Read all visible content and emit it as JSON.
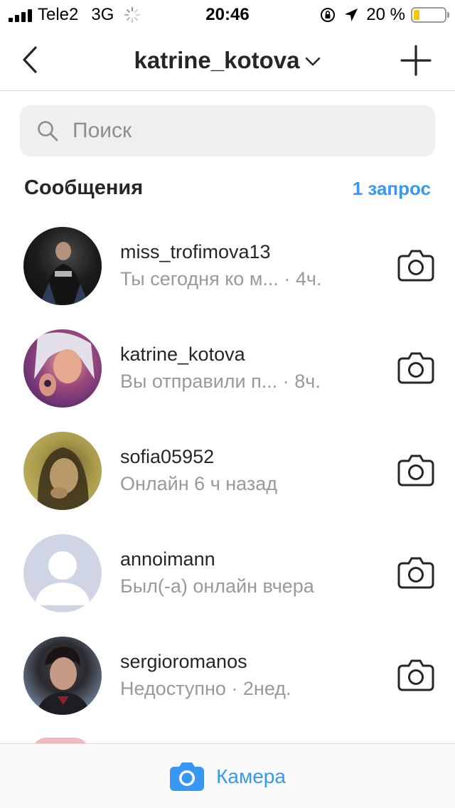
{
  "status_bar": {
    "carrier": "Tele2",
    "network": "3G",
    "time": "20:46",
    "battery_percent": "20 %",
    "battery_level": 0.2,
    "icons": [
      "signal-icon",
      "activity-spinner-icon",
      "orientation-lock-icon",
      "location-arrow-icon",
      "battery-icon"
    ]
  },
  "nav": {
    "title": "katrine_kotova",
    "back_icon": "chevron-left-icon",
    "title_icon": "chevron-down-icon",
    "new_message_icon": "plus-icon"
  },
  "search": {
    "placeholder": "Поиск",
    "icon": "search-icon"
  },
  "messages": {
    "section_title": "Сообщения",
    "requests_label": "1 запрос",
    "items": [
      {
        "username": "miss_trofimova13",
        "subtitle": "Ты сегодня ко м... · 4ч.",
        "icon": "camera-icon"
      },
      {
        "username": "katrine_kotova",
        "subtitle": "Вы отправили п... · 8ч.",
        "icon": "camera-icon"
      },
      {
        "username": "sofia05952",
        "subtitle": "Онлайн 6 ч назад",
        "icon": "camera-icon"
      },
      {
        "username": "annoimann",
        "subtitle": "Был(-а) онлайн вчера",
        "icon": "camera-icon"
      },
      {
        "username": "sergioromanos",
        "subtitle": "Недоступно · 2нед.",
        "icon": "camera-icon"
      }
    ]
  },
  "bottom_bar": {
    "label": "Камера",
    "icon": "camera-filled-icon",
    "accent_color": "#3897f0"
  },
  "colors": {
    "accent": "#3897f0",
    "text_primary": "#262626",
    "text_secondary": "#999999",
    "search_bg": "#efefef",
    "battery": "#f5c700"
  }
}
